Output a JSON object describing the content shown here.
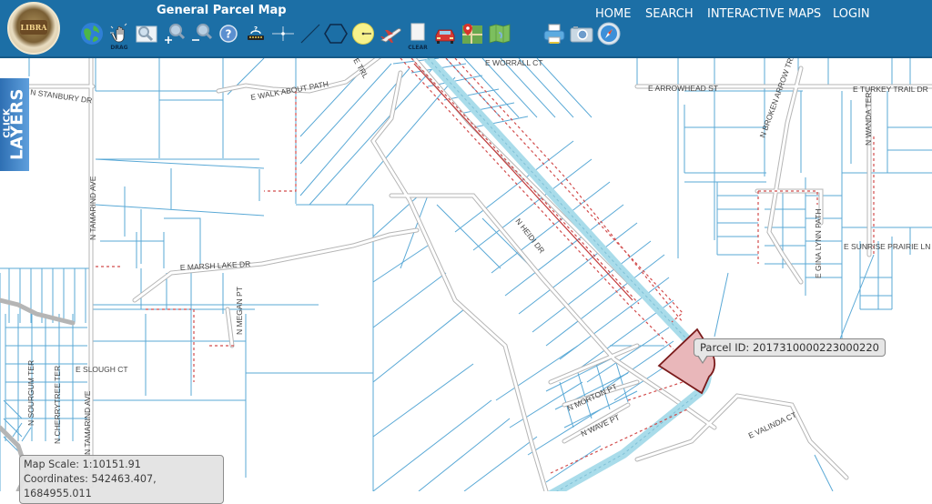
{
  "header": {
    "title": "General Parcel Map",
    "logo_text": "LIBRA",
    "nav": [
      "HOME",
      "SEARCH",
      "INTERACTIVE MAPS",
      "LOGIN"
    ]
  },
  "toolbar": {
    "tools": [
      {
        "name": "globe-full-extent",
        "icon": "globe-icon",
        "caption": ""
      },
      {
        "name": "drag-pan",
        "icon": "drag-hand-icon",
        "caption": "DRAG"
      },
      {
        "name": "zoom-box",
        "icon": "zoom-box-icon",
        "caption": ""
      },
      {
        "name": "zoom-in",
        "icon": "zoom-in-icon",
        "caption": ""
      },
      {
        "name": "zoom-out",
        "icon": "zoom-out-icon",
        "caption": ""
      },
      {
        "name": "help",
        "icon": "help-icon",
        "caption": ""
      },
      {
        "name": "identify",
        "icon": "identify-icon",
        "caption": ""
      },
      {
        "name": "point",
        "icon": "point-crosshair-icon",
        "caption": ""
      },
      {
        "name": "line",
        "icon": "line-measure-icon",
        "caption": ""
      },
      {
        "name": "polygon",
        "icon": "polygon-icon",
        "caption": ""
      },
      {
        "name": "circle-radius",
        "icon": "circle-radius-icon",
        "caption": ""
      },
      {
        "name": "aerial",
        "icon": "airplane-icon",
        "caption": ""
      },
      {
        "name": "clear",
        "icon": "clear-icon",
        "caption": "CLEAR"
      },
      {
        "name": "street-view",
        "icon": "car-icon",
        "caption": ""
      },
      {
        "name": "google-maps",
        "icon": "map-pin-icon",
        "caption": ""
      },
      {
        "name": "basemap",
        "icon": "folded-map-icon",
        "caption": ""
      },
      {
        "name": "print",
        "icon": "printer-icon",
        "caption": ""
      },
      {
        "name": "snapshot",
        "icon": "camera-icon",
        "caption": ""
      },
      {
        "name": "compass",
        "icon": "compass-icon",
        "caption": ""
      }
    ]
  },
  "layers_tab": {
    "line1": "CLICK",
    "line2": "LAYERS"
  },
  "map": {
    "street_labels": [
      "N STANBURY DR",
      "E WALK ABOUT PATH",
      "E TRL",
      "E WORRALL CT",
      "E ARROWHEAD ST",
      "N BROKEN ARROW TRL",
      "E TURKEY TRAIL DR",
      "N WANDA TER",
      "N TAMARIND AVE",
      "N HEIDI DR",
      "E GINA LYNN PATH",
      "E SUNRISE PRAIRIE LN",
      "E MARSH LAKE DR",
      "N MEGAN PT",
      "E SLOUGH CT",
      "N SOURGUM TER",
      "N CHERRYTREE TER",
      "N TAMARIND AVE",
      "N MORTON PT",
      "N WAVE PT",
      "E VALINDA CT"
    ],
    "selected_parcel": {
      "label": "Parcel ID:",
      "id": "2017310000223000220"
    },
    "colors": {
      "parcel_line": "#5aa9d6",
      "road": "#b8b8b8",
      "easement": "#d24c4c",
      "selected_fill": "#e9b7ba",
      "water": "#a9dcea"
    }
  },
  "status": {
    "scale_label": "Map Scale:",
    "scale_value": "1:10151.91",
    "coords_label": "Coordinates:",
    "coords_value": "542463.407, 1684955.011"
  }
}
